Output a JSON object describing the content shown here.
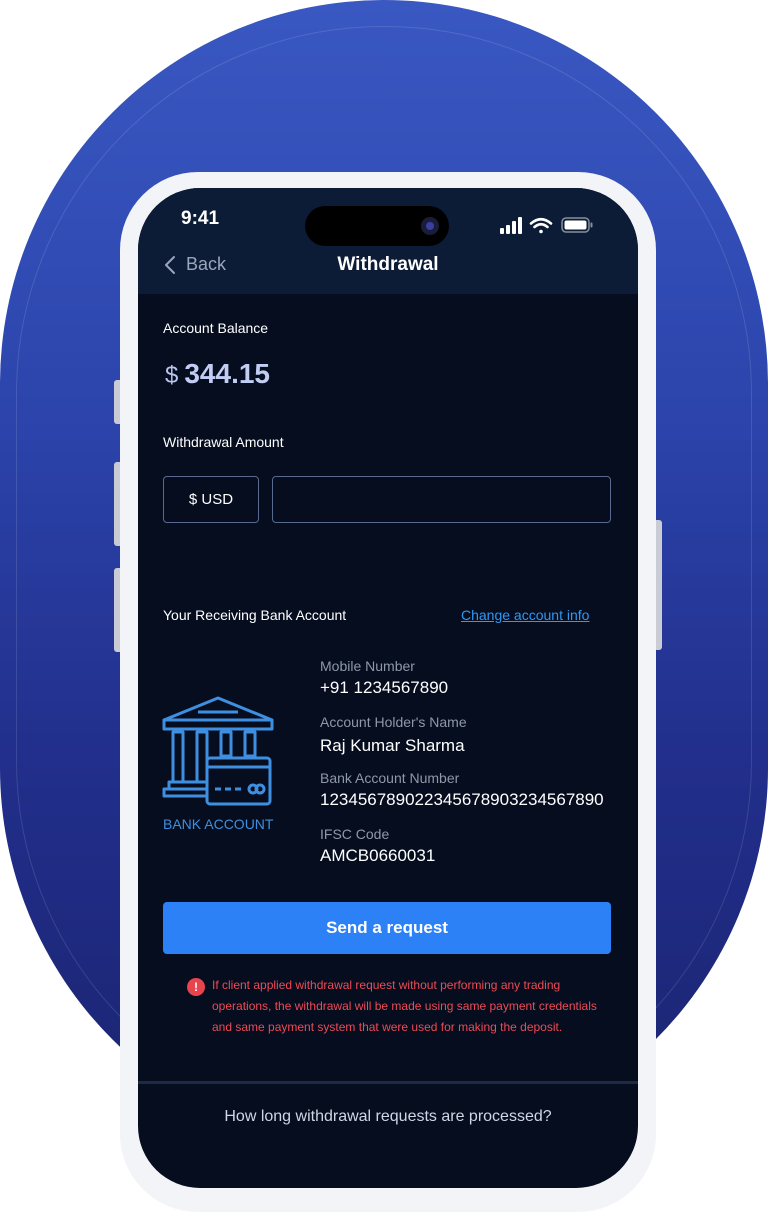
{
  "status_bar": {
    "time": "9:41"
  },
  "nav": {
    "back_label": "Back",
    "title": "Withdrawal"
  },
  "balance": {
    "label": "Account Balance",
    "currency_symbol": "$",
    "amount": "344.15"
  },
  "withdrawal": {
    "label": "Withdrawal Amount",
    "currency": "$ USD",
    "amount_value": ""
  },
  "bank": {
    "section_label": "Your Receiving Bank Account",
    "change_link": "Change account info",
    "icon_caption": "BANK ACCOUNT",
    "mobile_label": "Mobile Number",
    "mobile_value": "+91 1234567890",
    "holder_label": "Account Holder's Name",
    "holder_value": "Raj Kumar Sharma",
    "account_label": "Bank Account Number",
    "account_value": "123456789022345678903234567890",
    "ifsc_label": "IFSC Code",
    "ifsc_value": "AMCB0660031"
  },
  "send_button": "Send a request",
  "warning": "If client applied withdrawal request without performing any trading operations, the withdrawal will be made using same payment credentials and same payment system that were used for making the deposit.",
  "faq_item": "How long withdrawal requests are processed?",
  "colors": {
    "background": "#050d1f",
    "header": "#0d1c36",
    "accent": "#2c81f6",
    "link": "#2f98f3",
    "warning": "#ee4a55",
    "pill": "#2c45ad"
  },
  "icons": [
    "chevron-left-icon",
    "signal-icon",
    "wifi-icon",
    "battery-icon",
    "bank-icon",
    "alert-icon"
  ]
}
